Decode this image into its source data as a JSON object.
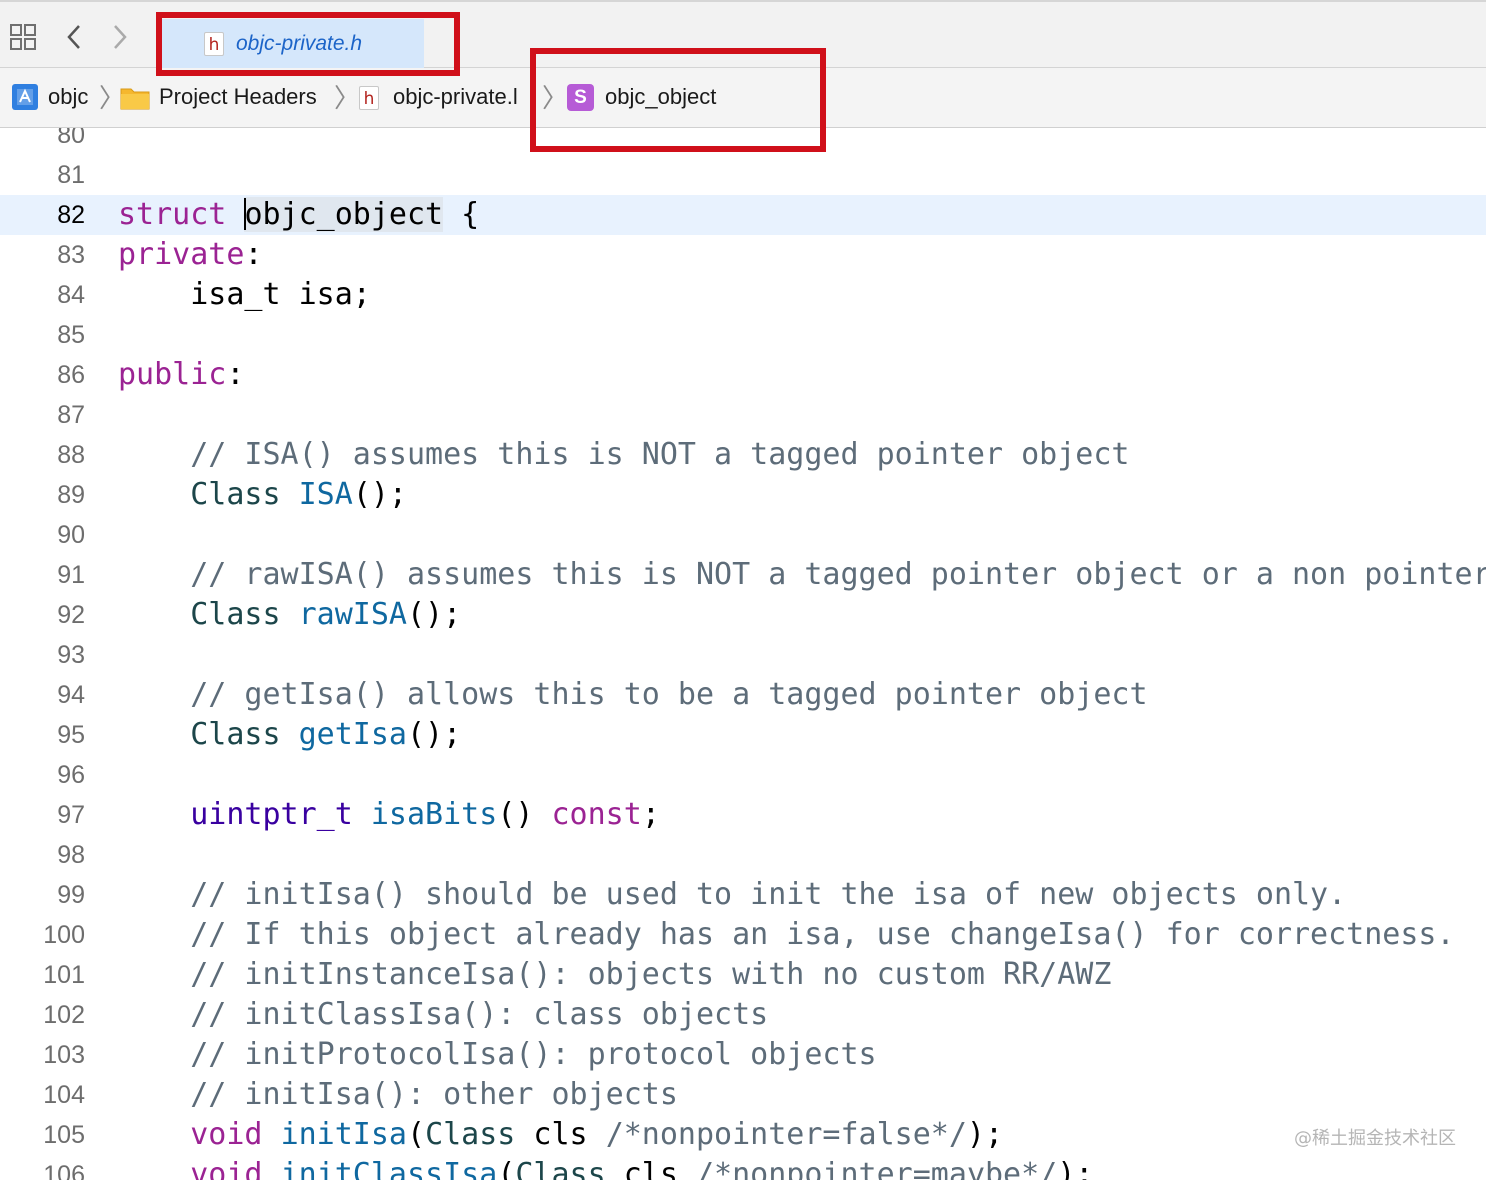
{
  "window": {
    "active_tab": "objc-private.h"
  },
  "breadcrumb": {
    "items": [
      "objc",
      "Project Headers",
      "objc-private.l",
      "objc_object"
    ]
  },
  "editor": {
    "current_line": 82,
    "lines": [
      {
        "num": "80",
        "tokens": []
      },
      {
        "num": "81",
        "tokens": []
      },
      {
        "num": "82",
        "tokens": [
          {
            "t": "struct",
            "c": "kw"
          },
          {
            "t": " "
          },
          {
            "t": "CURSOR"
          },
          {
            "t": "objc_object",
            "c": "hl"
          },
          {
            "t": " {"
          }
        ]
      },
      {
        "num": "83",
        "tokens": [
          {
            "t": "private",
            "c": "kw"
          },
          {
            "t": ":"
          }
        ]
      },
      {
        "num": "84",
        "tokens": [
          {
            "t": "    isa_t isa;"
          }
        ]
      },
      {
        "num": "85",
        "tokens": []
      },
      {
        "num": "86",
        "tokens": [
          {
            "t": "public",
            "c": "kw"
          },
          {
            "t": ":"
          }
        ]
      },
      {
        "num": "87",
        "tokens": []
      },
      {
        "num": "88",
        "tokens": [
          {
            "t": "    // ISA() assumes this is NOT a tagged pointer object",
            "c": "cm"
          }
        ]
      },
      {
        "num": "89",
        "tokens": [
          {
            "t": "    "
          },
          {
            "t": "Class",
            "c": "tp"
          },
          {
            "t": " "
          },
          {
            "t": "ISA",
            "c": "fn"
          },
          {
            "t": "();"
          }
        ]
      },
      {
        "num": "90",
        "tokens": []
      },
      {
        "num": "91",
        "tokens": [
          {
            "t": "    // rawISA() assumes this is NOT a tagged pointer object or a non pointer ISA",
            "c": "cm"
          }
        ]
      },
      {
        "num": "92",
        "tokens": [
          {
            "t": "    "
          },
          {
            "t": "Class",
            "c": "tp"
          },
          {
            "t": " "
          },
          {
            "t": "rawISA",
            "c": "fn"
          },
          {
            "t": "();"
          }
        ]
      },
      {
        "num": "93",
        "tokens": []
      },
      {
        "num": "94",
        "tokens": [
          {
            "t": "    // getIsa() allows this to be a tagged pointer object",
            "c": "cm"
          }
        ]
      },
      {
        "num": "95",
        "tokens": [
          {
            "t": "    "
          },
          {
            "t": "Class",
            "c": "tp"
          },
          {
            "t": " "
          },
          {
            "t": "getIsa",
            "c": "fn"
          },
          {
            "t": "();"
          }
        ]
      },
      {
        "num": "96",
        "tokens": []
      },
      {
        "num": "97",
        "tokens": [
          {
            "t": "    "
          },
          {
            "t": "uintptr_t",
            "c": "ty2"
          },
          {
            "t": " "
          },
          {
            "t": "isaBits",
            "c": "fn"
          },
          {
            "t": "() "
          },
          {
            "t": "const",
            "c": "kw"
          },
          {
            "t": ";"
          }
        ]
      },
      {
        "num": "98",
        "tokens": []
      },
      {
        "num": "99",
        "tokens": [
          {
            "t": "    // initIsa() should be used to init the isa of new objects only.",
            "c": "cm"
          }
        ]
      },
      {
        "num": "100",
        "tokens": [
          {
            "t": "    // If this object already has an isa, use changeIsa() for correctness.",
            "c": "cm"
          }
        ]
      },
      {
        "num": "101",
        "tokens": [
          {
            "t": "    // initInstanceIsa(): objects with no custom RR/AWZ",
            "c": "cm"
          }
        ]
      },
      {
        "num": "102",
        "tokens": [
          {
            "t": "    // initClassIsa(): class objects",
            "c": "cm"
          }
        ]
      },
      {
        "num": "103",
        "tokens": [
          {
            "t": "    // initProtocolIsa(): protocol objects",
            "c": "cm"
          }
        ]
      },
      {
        "num": "104",
        "tokens": [
          {
            "t": "    // initIsa(): other objects",
            "c": "cm"
          }
        ]
      },
      {
        "num": "105",
        "tokens": [
          {
            "t": "    "
          },
          {
            "t": "void",
            "c": "kw"
          },
          {
            "t": " "
          },
          {
            "t": "initIsa",
            "c": "fn"
          },
          {
            "t": "("
          },
          {
            "t": "Class",
            "c": "tp"
          },
          {
            "t": " cls "
          },
          {
            "t": "/*nonpointer=false*/",
            "c": "cm"
          },
          {
            "t": ");"
          }
        ]
      },
      {
        "num": "106",
        "tokens": [
          {
            "t": "    "
          },
          {
            "t": "void",
            "c": "kw"
          },
          {
            "t": " "
          },
          {
            "t": "initClassIsa",
            "c": "fn"
          },
          {
            "t": "("
          },
          {
            "t": "Class",
            "c": "tp"
          },
          {
            "t": " cls "
          },
          {
            "t": "/*nonpointer=maybe*/",
            "c": "cm"
          },
          {
            "t": ");"
          }
        ]
      }
    ]
  },
  "watermark": "@稀土掘金技术社区",
  "colors": {
    "highlight_box": "#d0101a",
    "tab_active_bg": "#d5e7fb",
    "keyword": "#9b2393",
    "comment": "#5d6c79",
    "function": "#0f68a0"
  },
  "icons": [
    "grid-icon",
    "back-chevron-icon",
    "forward-chevron-icon",
    "header-file-icon",
    "project-icon",
    "folder-icon",
    "struct-icon"
  ]
}
